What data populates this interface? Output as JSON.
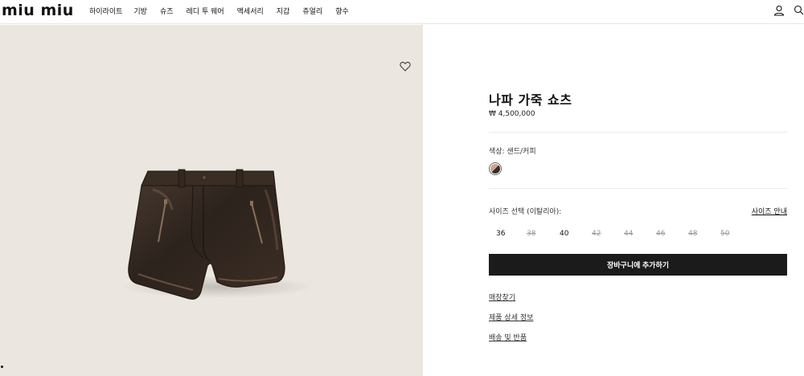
{
  "header": {
    "logo": "miu miu",
    "nav": [
      "하이라이트",
      "기방",
      "슈즈",
      "레디 투 웨어",
      "액세서리",
      "지갑",
      "쥬얼리",
      "향수"
    ]
  },
  "product": {
    "title": "나파 가죽 쇼츠",
    "price": "₩ 4,500,000",
    "color_label": "색상: 샌드/커피",
    "size_label": "사이즈 선택 (이탈리아):",
    "size_guide": "사이즈 안내",
    "sizes": [
      {
        "label": "36",
        "available": true
      },
      {
        "label": "38",
        "available": false
      },
      {
        "label": "40",
        "available": true
      },
      {
        "label": "42",
        "available": false
      },
      {
        "label": "44",
        "available": false
      },
      {
        "label": "46",
        "available": false
      },
      {
        "label": "48",
        "available": false
      },
      {
        "label": "50",
        "available": false
      }
    ],
    "add_to_cart": "장바구니에 추가하기",
    "links": [
      "매장찾기",
      "제품 상세 정보",
      "배송 및 반품"
    ]
  },
  "icons": {
    "account": "user-icon",
    "search": "search-icon",
    "wishlist": "heart-icon"
  },
  "colors": {
    "button": "#1b1b1b",
    "image_bg": "#ebe6df",
    "unavailable": "#9a9a9a"
  }
}
